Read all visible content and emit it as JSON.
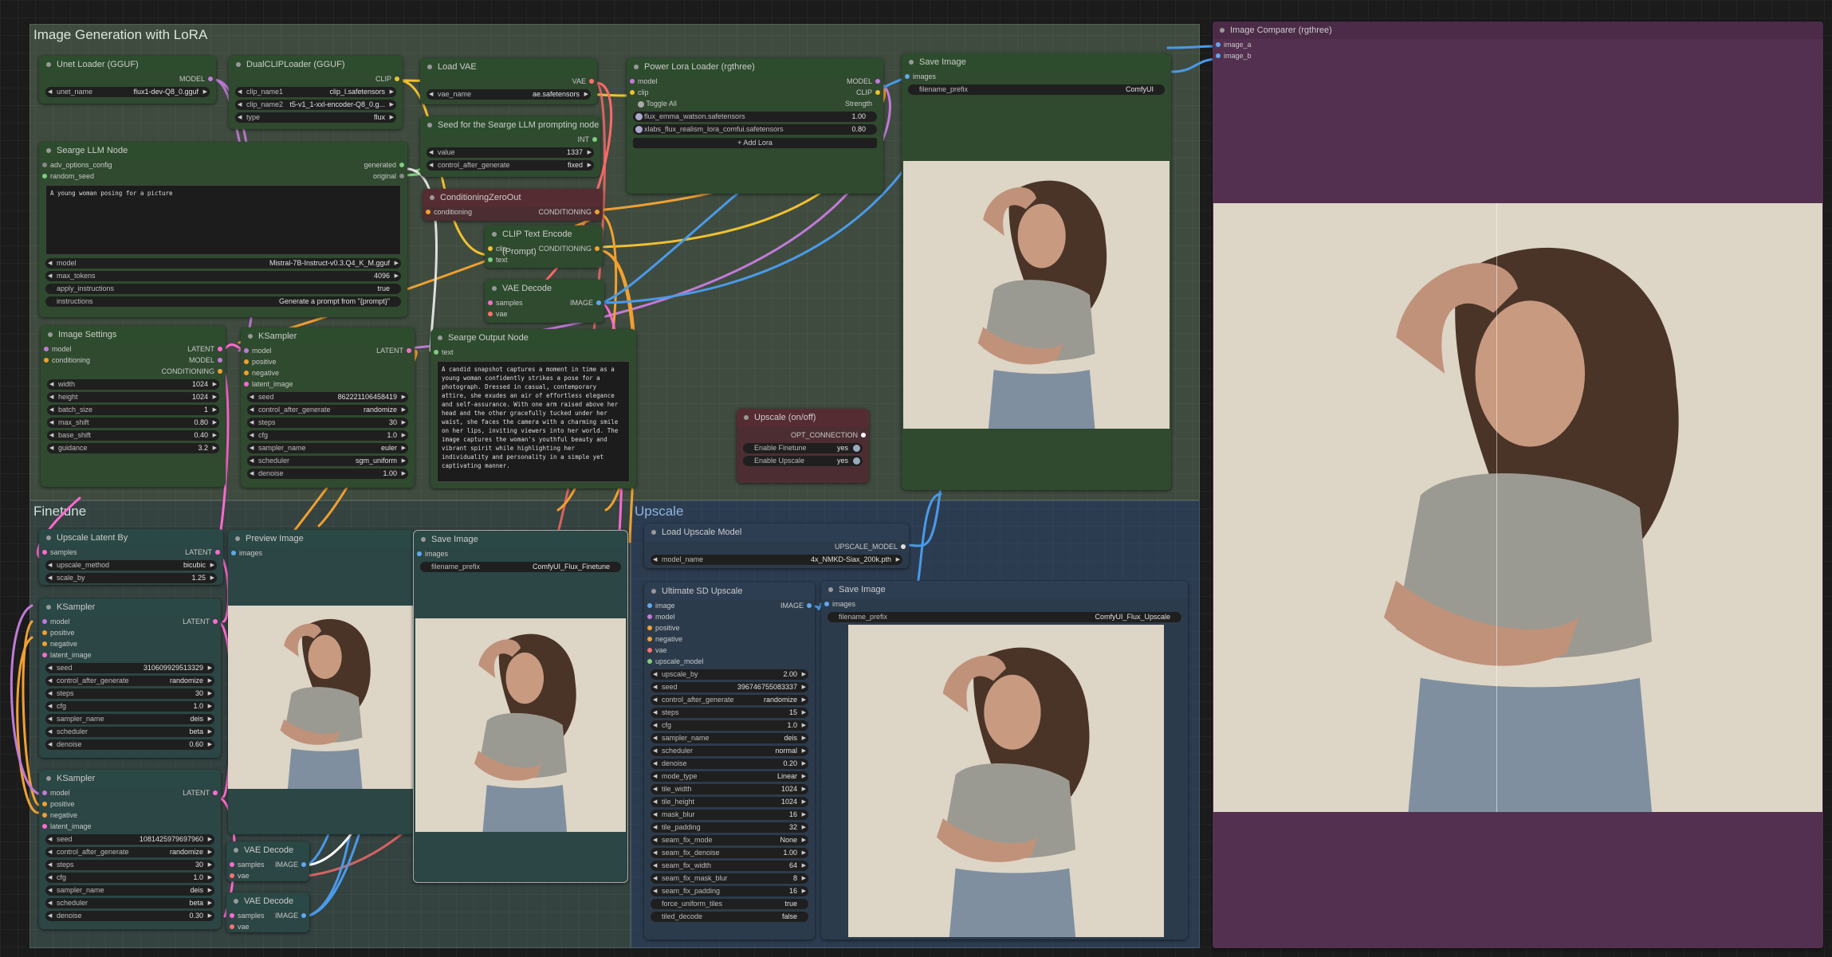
{
  "groups": {
    "lora": "Image Generation with LoRA",
    "finetune": "Finetune",
    "upscale": "Upscale"
  },
  "unet": {
    "title": "Unet Loader (GGUF)",
    "out": "MODEL",
    "w": {
      "l": "unet_name",
      "v": "flux1-dev-Q8_0.gguf"
    }
  },
  "dualclip": {
    "title": "DualCLIPLoader (GGUF)",
    "out": "CLIP",
    "w": [
      {
        "l": "clip_name1",
        "v": "clip_l.safetensors"
      },
      {
        "l": "clip_name2",
        "v": "t5-v1_1-xxl-encoder-Q8_0.g..."
      },
      {
        "l": "type",
        "v": "flux"
      }
    ]
  },
  "loadvae": {
    "title": "Load VAE",
    "out": "VAE",
    "w": {
      "l": "vae_name",
      "v": "ae.safetensors"
    }
  },
  "seed_llm": {
    "title": "Seed for the Searge LLM prompting node",
    "out": "INT",
    "w": [
      {
        "l": "value",
        "v": "1337"
      },
      {
        "l": "control_after_generate",
        "v": "fixed"
      }
    ]
  },
  "lora": {
    "title": "Power Lora Loader (rgthree)",
    "in": [
      "model",
      "clip"
    ],
    "out": [
      "MODEL",
      "CLIP"
    ],
    "toggle": "Toggle All",
    "strength": "Strength",
    "loras": [
      {
        "l": "flux_emma_watson.safetensors",
        "v": "1.00"
      },
      {
        "l": "xlabs_flux_realism_lora_comfui.safetensors",
        "v": "0.80"
      }
    ],
    "add": "Add Lora"
  },
  "save1": {
    "title": "Save Image",
    "in": "images",
    "w": {
      "l": "filename_prefix",
      "v": "ComfyUI"
    }
  },
  "llm": {
    "title": "Searge LLM Node",
    "in": [
      "adv_options_config",
      "random_seed"
    ],
    "out": [
      "generated",
      "original"
    ],
    "text": "A young woman posing for a picture",
    "w": [
      {
        "l": "model",
        "v": "Mistral-7B-Instruct-v0.3.Q4_K_M.gguf"
      },
      {
        "l": "max_tokens",
        "v": "4096"
      },
      {
        "l": "apply_instructions",
        "v": "true"
      },
      {
        "l": "instructions",
        "v": "Generate a prompt from \"{prompt}\""
      }
    ]
  },
  "czero": {
    "title": "ConditioningZeroOut",
    "in": "conditioning",
    "out": "CONDITIONING"
  },
  "clipenc": {
    "title": "CLIP Text Encode (Prompt)",
    "in": [
      "clip",
      "text"
    ],
    "out": "CONDITIONING"
  },
  "vaedec1": {
    "title": "VAE Decode",
    "in": [
      "samples",
      "vae"
    ],
    "out": "IMAGE"
  },
  "imgset": {
    "title": "Image Settings",
    "in": [
      "model",
      "conditioning"
    ],
    "out": [
      "LATENT",
      "MODEL",
      "CONDITIONING"
    ],
    "w": [
      {
        "l": "width",
        "v": "1024"
      },
      {
        "l": "height",
        "v": "1024"
      },
      {
        "l": "batch_size",
        "v": "1"
      },
      {
        "l": "max_shift",
        "v": "0.80"
      },
      {
        "l": "base_shift",
        "v": "0.40"
      },
      {
        "l": "guidance",
        "v": "3.2"
      }
    ]
  },
  "ks1": {
    "title": "KSampler",
    "in": [
      "model",
      "positive",
      "negative",
      "latent_image"
    ],
    "out": "LATENT",
    "w": [
      {
        "l": "seed",
        "v": "862221106458419"
      },
      {
        "l": "control_after_generate",
        "v": "randomize"
      },
      {
        "l": "steps",
        "v": "30"
      },
      {
        "l": "cfg",
        "v": "1.0"
      },
      {
        "l": "sampler_name",
        "v": "euler"
      },
      {
        "l": "scheduler",
        "v": "sgm_uniform"
      },
      {
        "l": "denoise",
        "v": "1.00"
      }
    ]
  },
  "searge_out": {
    "title": "Searge Output Node",
    "in": "text",
    "text": "A candid snapshot captures a moment in time as a young woman confidently strikes a pose for a photograph. Dressed in casual, contemporary attire, she exudes an air of effortless elegance and self-assurance. With one arm raised above her head and the other gracefully tucked under her waist, she faces the camera with a charming smile on her lips, inviting viewers into her world. The image captures the woman's youthful beauty and vibrant spirit while highlighting her individuality and personality in a simple yet captivating manner."
  },
  "upsw": {
    "title": "Upscale (on/off)",
    "out": "OPT_CONNECTION",
    "w": [
      {
        "l": "Enable Finetune",
        "v": "yes"
      },
      {
        "l": "Enable Upscale",
        "v": "yes"
      }
    ]
  },
  "upslat": {
    "title": "Upscale Latent By",
    "in": "samples",
    "out": "LATENT",
    "w": [
      {
        "l": "upscale_method",
        "v": "bicubic"
      },
      {
        "l": "scale_by",
        "v": "1.25"
      }
    ]
  },
  "preview": {
    "title": "Preview Image",
    "in": "images"
  },
  "save2": {
    "title": "Save Image",
    "in": "images",
    "w": {
      "l": "filename_prefix",
      "v": "ComfyUI_Flux_Finetune"
    }
  },
  "ks2": {
    "title": "KSampler",
    "in": [
      "model",
      "positive",
      "negative",
      "latent_image"
    ],
    "out": "LATENT",
    "w": [
      {
        "l": "seed",
        "v": "310609929513329"
      },
      {
        "l": "control_after_generate",
        "v": "randomize"
      },
      {
        "l": "steps",
        "v": "30"
      },
      {
        "l": "cfg",
        "v": "1.0"
      },
      {
        "l": "sampler_name",
        "v": "deis"
      },
      {
        "l": "scheduler",
        "v": "beta"
      },
      {
        "l": "denoise",
        "v": "0.60"
      }
    ]
  },
  "ks3": {
    "title": "KSampler",
    "in": [
      "model",
      "positive",
      "negative",
      "latent_image"
    ],
    "out": "LATENT",
    "w": [
      {
        "l": "seed",
        "v": "1081425979697960"
      },
      {
        "l": "control_after_generate",
        "v": "randomize"
      },
      {
        "l": "steps",
        "v": "30"
      },
      {
        "l": "cfg",
        "v": "1.0"
      },
      {
        "l": "sampler_name",
        "v": "deis"
      },
      {
        "l": "scheduler",
        "v": "beta"
      },
      {
        "l": "denoise",
        "v": "0.30"
      }
    ]
  },
  "vaedec2": {
    "title": "VAE Decode",
    "in": [
      "samples",
      "vae"
    ],
    "out": "IMAGE"
  },
  "vaedec3": {
    "title": "VAE Decode",
    "in": [
      "samples",
      "vae"
    ],
    "out": "IMAGE"
  },
  "loadups": {
    "title": "Load Upscale Model",
    "out": "UPSCALE_MODEL",
    "w": {
      "l": "model_name",
      "v": "4x_NMKD-Siax_200k.pth"
    }
  },
  "usd": {
    "title": "Ultimate SD Upscale",
    "in": [
      "image",
      "model",
      "positive",
      "negative",
      "vae",
      "upscale_model"
    ],
    "out": "IMAGE",
    "w": [
      {
        "l": "upscale_by",
        "v": "2.00"
      },
      {
        "l": "seed",
        "v": "396746755083337"
      },
      {
        "l": "control_after_generate",
        "v": "randomize"
      },
      {
        "l": "steps",
        "v": "15"
      },
      {
        "l": "cfg",
        "v": "1.0"
      },
      {
        "l": "sampler_name",
        "v": "deis"
      },
      {
        "l": "scheduler",
        "v": "normal"
      },
      {
        "l": "denoise",
        "v": "0.20"
      },
      {
        "l": "mode_type",
        "v": "Linear"
      },
      {
        "l": "tile_width",
        "v": "1024"
      },
      {
        "l": "tile_height",
        "v": "1024"
      },
      {
        "l": "mask_blur",
        "v": "16"
      },
      {
        "l": "tile_padding",
        "v": "32"
      },
      {
        "l": "seam_fix_mode",
        "v": "None"
      },
      {
        "l": "seam_fix_denoise",
        "v": "1.00"
      },
      {
        "l": "seam_fix_width",
        "v": "64"
      },
      {
        "l": "seam_fix_mask_blur",
        "v": "8"
      },
      {
        "l": "seam_fix_padding",
        "v": "16"
      },
      {
        "l": "force_uniform_tiles",
        "v": "true"
      },
      {
        "l": "tiled_decode",
        "v": "false"
      }
    ]
  },
  "save3": {
    "title": "Save Image",
    "in": "images",
    "w": {
      "l": "filename_prefix",
      "v": "ComfyUI_Flux_Upscale"
    }
  },
  "comparer": {
    "title": "Image Comparer (rgthree)",
    "in": [
      "image_a",
      "image_b"
    ]
  }
}
